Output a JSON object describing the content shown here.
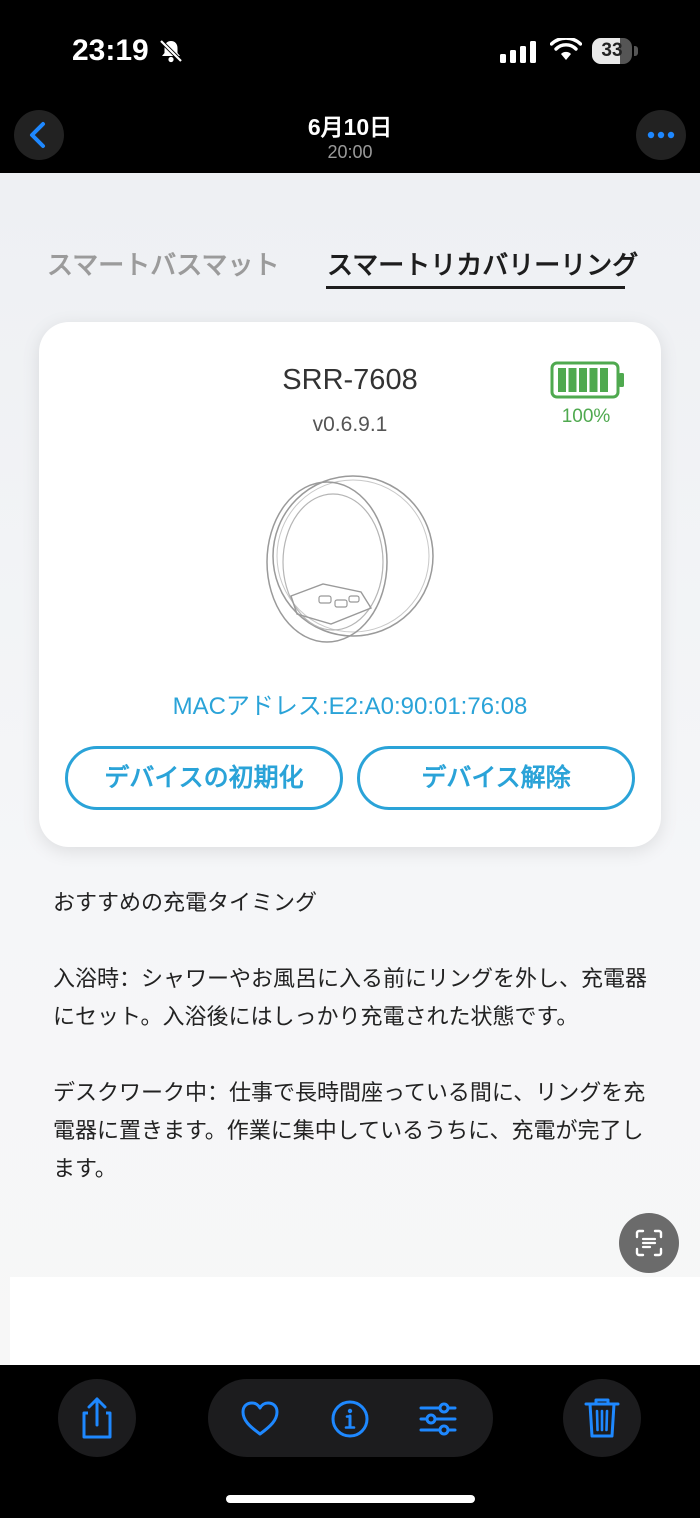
{
  "status_bar": {
    "time": "23:19",
    "battery_level": "33",
    "icons": [
      "bell-slash-icon",
      "cellular-signal-icon",
      "wifi-icon",
      "battery-icon"
    ]
  },
  "nav": {
    "title": "6月10日",
    "subtitle": "20:00",
    "icons": [
      "chevron-left-icon",
      "ellipsis-icon"
    ]
  },
  "tabs": {
    "items": [
      {
        "label": "スマートバスマット",
        "selected": false
      },
      {
        "label": "スマートリカバリーリング",
        "selected": true
      }
    ]
  },
  "device": {
    "model": "SRR-7608",
    "version": "v0.6.9.1",
    "battery_percent": "100%",
    "battery_fraction": 1.0,
    "mac": "MACアドレス:E2:A0:90:01:76:08",
    "reset_label": "デバイスの初期化",
    "unpair_label": "デバイス解除"
  },
  "info": {
    "heading": "おすすめの充電タイミング",
    "bath": "入浴時：シャワーやお風呂に入る前にリングを外し、充電器にセット。入浴後にはしっかり充電された状態です。",
    "desk": "デスクワーク中：仕事で長時間座っている間に、リングを充電器に置きます。作業に集中しているうちに、充電が完了します。"
  },
  "toolbar": {
    "icons": [
      "share-icon",
      "heart-icon",
      "info-icon",
      "sliders-icon",
      "trash-icon"
    ]
  },
  "colors": {
    "accent": "#2aa3d8",
    "battery_green": "#4fa94f",
    "ios_blue": "#1e88ff"
  }
}
